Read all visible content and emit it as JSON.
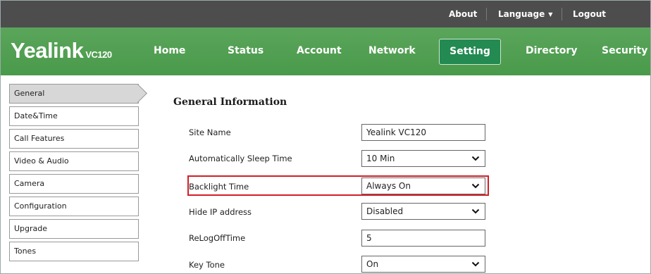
{
  "topbar": {
    "about": "About",
    "language": "Language",
    "logout": "Logout"
  },
  "brand": {
    "name": "Yealink",
    "model": "VC120"
  },
  "nav": {
    "home": "Home",
    "status": "Status",
    "account": "Account",
    "network": "Network",
    "setting": "Setting",
    "directory": "Directory",
    "security": "Security",
    "active": "Setting"
  },
  "sidebar": {
    "items": [
      {
        "label": "General",
        "active": true
      },
      {
        "label": "Date&Time"
      },
      {
        "label": "Call Features"
      },
      {
        "label": "Video & Audio"
      },
      {
        "label": "Camera"
      },
      {
        "label": "Configuration"
      },
      {
        "label": "Upgrade"
      },
      {
        "label": "Tones"
      }
    ]
  },
  "main": {
    "section_title": "General Information",
    "rows": [
      {
        "label": "Site Name",
        "type": "text",
        "value": "Yealink VC120"
      },
      {
        "label": "Automatically Sleep Time",
        "type": "select",
        "value": "10 Min"
      },
      {
        "label": "Backlight Time",
        "type": "select",
        "value": "Always On",
        "highlighted": true
      },
      {
        "label": "Hide IP address",
        "type": "select",
        "value": "Disabled"
      },
      {
        "label": "ReLogOffTime",
        "type": "text",
        "value": "5"
      },
      {
        "label": "Key Tone",
        "type": "select",
        "value": "On"
      }
    ]
  },
  "colors": {
    "topbar_bg": "#4d4d4d",
    "nav_bg": "#4f9e50",
    "nav_active_bg": "#238a52",
    "highlight_border": "#d11f27"
  },
  "icons": {
    "dropdown": "chevron-down-icon",
    "language_caret": "caret-down-icon"
  }
}
